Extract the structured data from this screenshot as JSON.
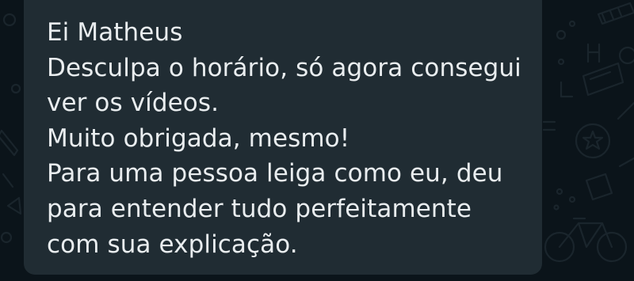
{
  "chat": {
    "message": {
      "lines": [
        "Ei Matheus",
        "Desculpa o horário, só agora consegui",
        "ver os vídeos.",
        "Muito obrigada, mesmo!",
        "Para uma pessoa leiga como eu, deu",
        "para entender tudo perfeitamente",
        "com sua explicação."
      ]
    },
    "colors": {
      "wallpaper": "#0b141a",
      "bubble": "#202c33",
      "text": "#e9edef",
      "doodle": "#1a252c"
    },
    "wallpaper_icons": [
      "pencil-icon",
      "circle-doodle-icon",
      "bicycle-icon",
      "gear-icon",
      "chair-icon",
      "star-icon"
    ]
  }
}
